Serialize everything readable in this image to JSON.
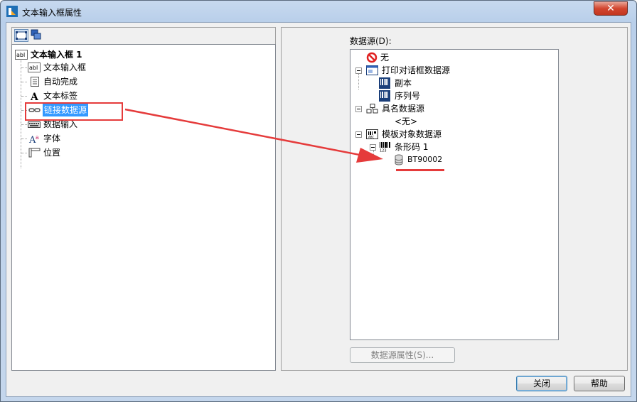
{
  "window": {
    "title": "文本输入框属性",
    "close_glyph": "✕"
  },
  "left_tree": {
    "root": {
      "label": "文本输入框 1",
      "icon": "text-field-icon"
    },
    "items": [
      {
        "label": "文本输入框",
        "icon": "text-field-icon"
      },
      {
        "label": "自动完成",
        "icon": "document-icon"
      },
      {
        "label": "文本标签",
        "icon": "letter-a-icon"
      },
      {
        "label": "链接数据源",
        "icon": "link-icon",
        "selected": true
      },
      {
        "label": "数据输入",
        "icon": "keyboard-icon"
      },
      {
        "label": "字体",
        "icon": "font-icon"
      },
      {
        "label": "位置",
        "icon": "ruler-icon"
      }
    ]
  },
  "right_panel": {
    "data_source_label": "数据源(D):",
    "tree": {
      "none_item": "无",
      "print_dialog_group": "打印对话框数据源",
      "print_dialog_children": [
        "副本",
        "序列号"
      ],
      "named_group": "具名数据源",
      "named_none": "<无>",
      "template_group": "模板对象数据源",
      "barcode_item": "条形码 1",
      "barcode_child": "BT90002"
    },
    "properties_button": "数据源属性(S)..."
  },
  "footer": {
    "close_button": "关闭",
    "help_button": "帮助"
  },
  "colors": {
    "annotation_red": "#e53b3b",
    "selection_blue": "#3399ff"
  }
}
